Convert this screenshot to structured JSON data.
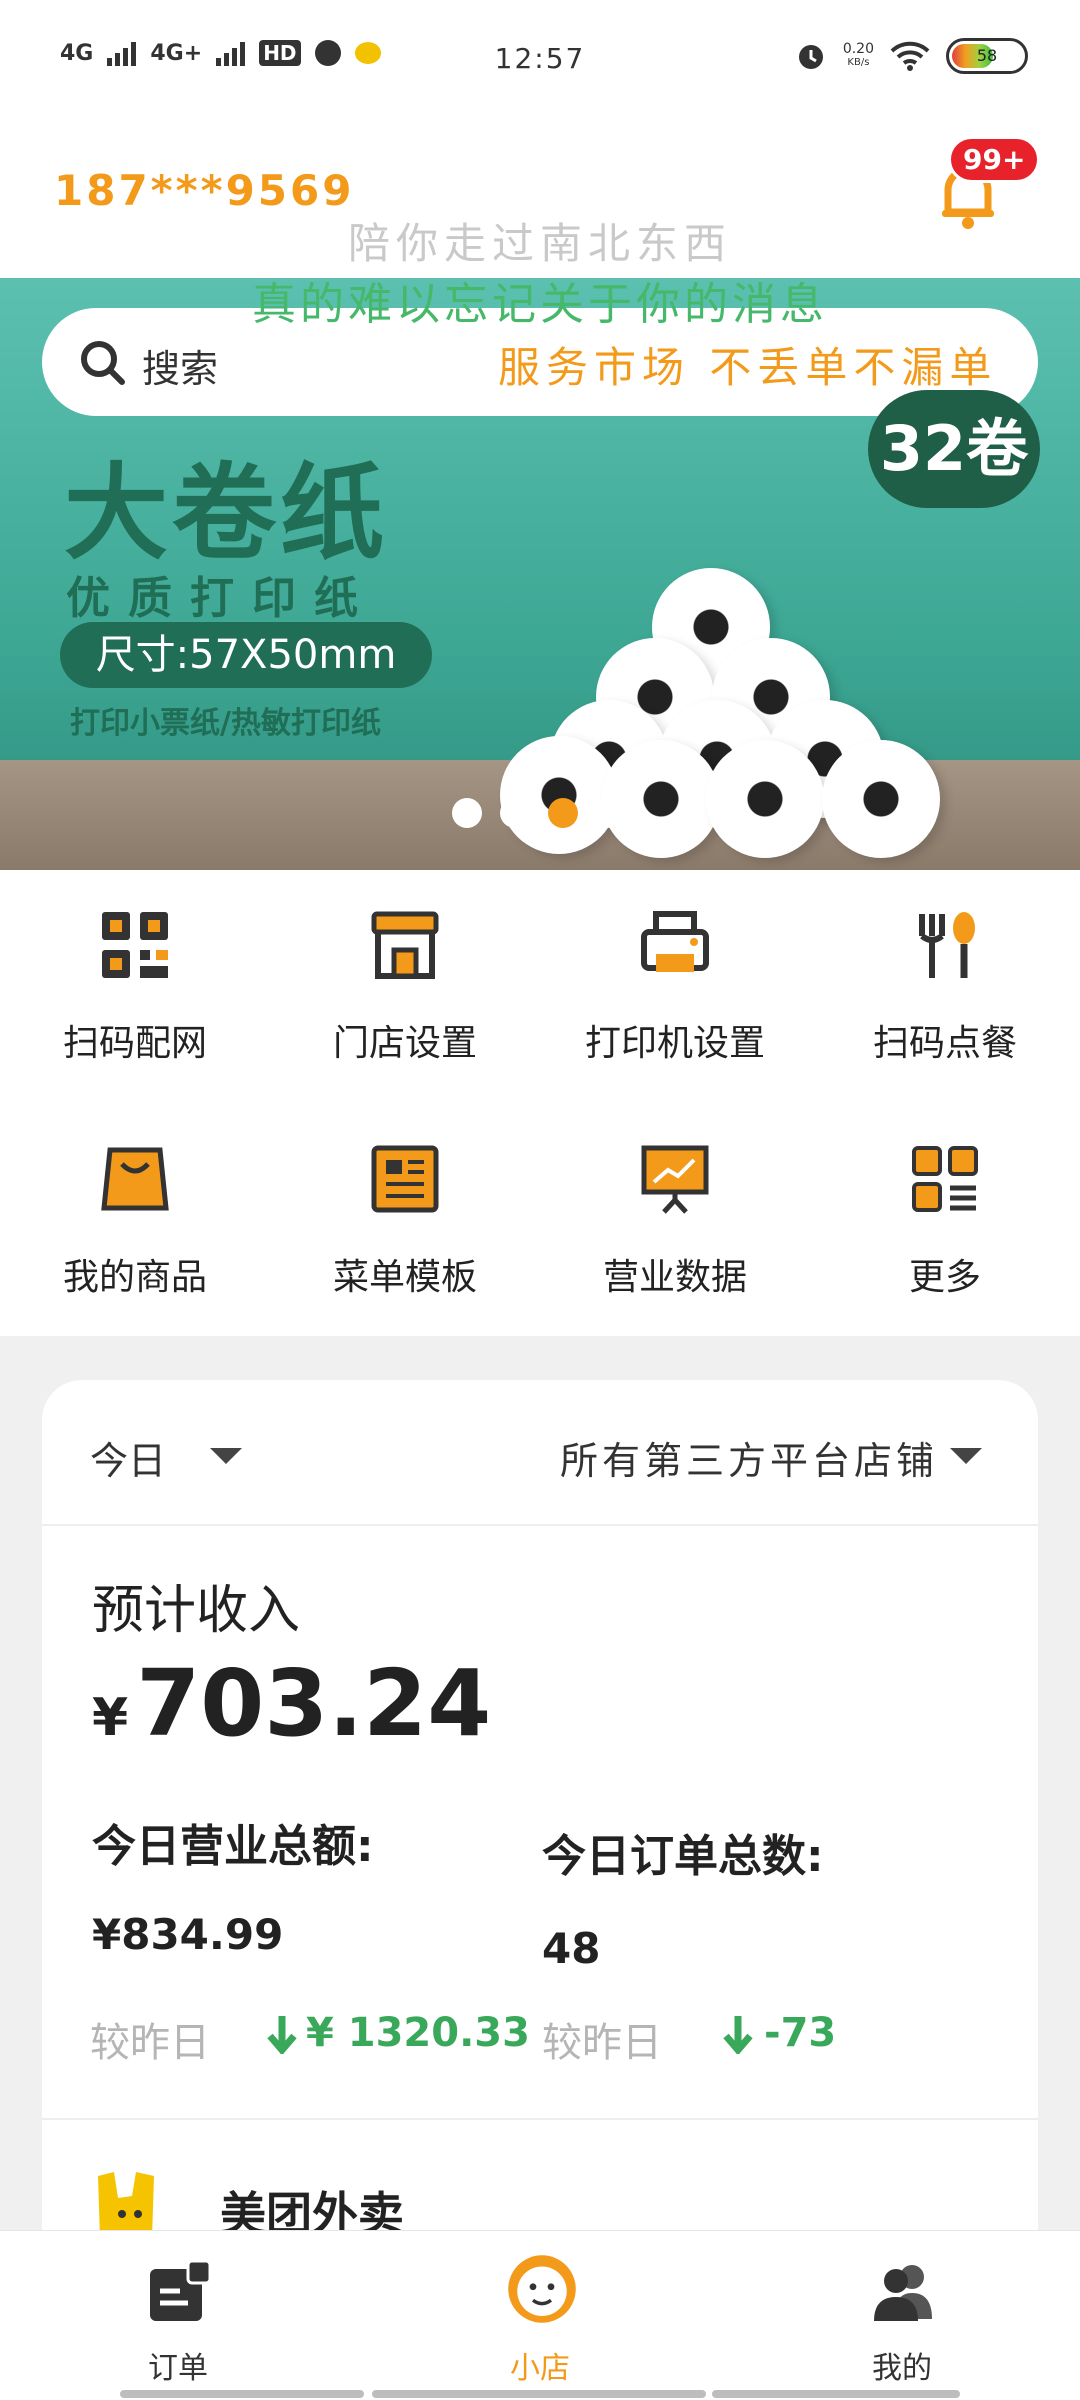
{
  "status_bar": {
    "network_1": "4G",
    "network_2": "4G+",
    "hd_label": "HD",
    "time": "12:57",
    "speed_value": "0.20",
    "speed_unit": "KB/s",
    "battery": "58"
  },
  "header": {
    "phone": "187***9569",
    "notification_badge": "99+"
  },
  "watermark": {
    "line1": "陪你走过南北东西",
    "line2": "真的难以忘记关于你的消息"
  },
  "search": {
    "placeholder": "搜索",
    "market_link": "服务市场 不丢单不漏单"
  },
  "banner": {
    "headline": "大卷纸",
    "quality": "优质打印纸",
    "size": "尺寸:57X50mm",
    "subtitle": "打印小票纸/热敏打印纸",
    "roll_count": "32卷",
    "slide_count": 4,
    "active_slide": 3
  },
  "grid": {
    "items": [
      {
        "label": "扫码配网",
        "icon": "qr-config-icon"
      },
      {
        "label": "门店设置",
        "icon": "store-icon"
      },
      {
        "label": "打印机设置",
        "icon": "printer-icon"
      },
      {
        "label": "扫码点餐",
        "icon": "fork-spoon-icon"
      },
      {
        "label": "我的商品",
        "icon": "bag-icon"
      },
      {
        "label": "菜单模板",
        "icon": "menu-template-icon"
      },
      {
        "label": "营业数据",
        "icon": "chart-board-icon"
      },
      {
        "label": "更多",
        "icon": "more-grid-icon"
      }
    ]
  },
  "stats": {
    "period": "今日",
    "shop_filter": "所有第三方平台店铺",
    "expected_income_label": "预计收入",
    "currency": "¥",
    "expected_income": "703.24",
    "revenue_label": "今日营业总额:",
    "revenue_value": "¥834.99",
    "orders_label": "今日订单总数:",
    "orders_value": "48",
    "compare_label": "较昨日",
    "revenue_change": "¥ 1320.33",
    "orders_change": "-73",
    "change_color": "#3aa85a"
  },
  "platform": {
    "name": "美团外卖",
    "icon": "meituan-kangaroo-icon"
  },
  "tabs": [
    {
      "label": "订单",
      "icon": "orders-icon"
    },
    {
      "label": "小店",
      "icon": "shop-mascot-icon"
    },
    {
      "label": "我的",
      "icon": "users-icon"
    }
  ],
  "colors": {
    "accent": "#f39a1a",
    "badge": "#e8222b",
    "banner_green": "#1f6e55"
  }
}
